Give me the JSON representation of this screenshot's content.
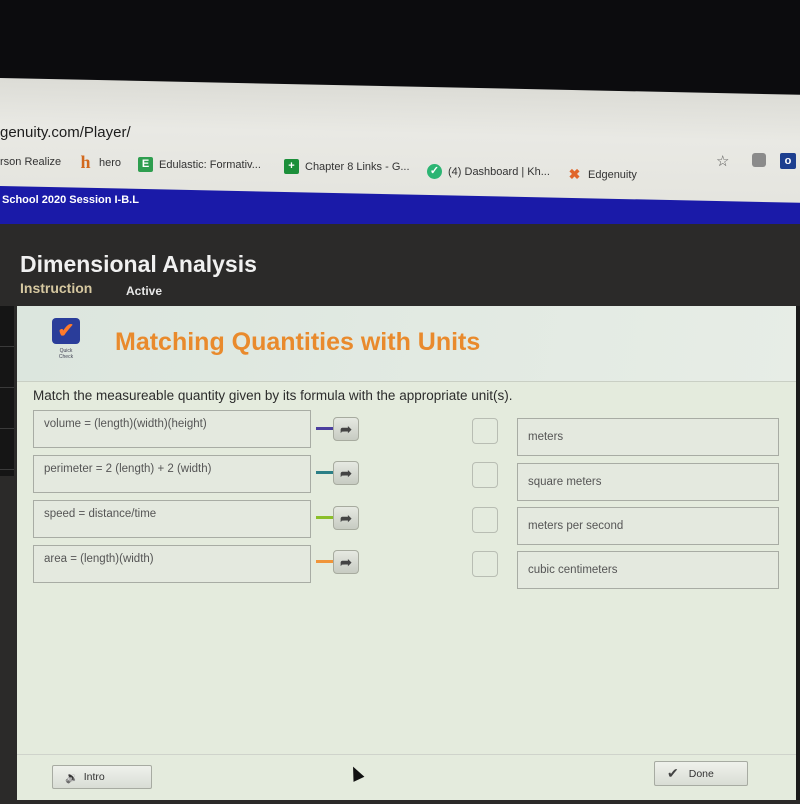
{
  "browser": {
    "url": "genuity.com/Player/",
    "bookmarks": [
      {
        "label": "rson Realize",
        "icon": "pearson-icon",
        "color": ""
      },
      {
        "label": "hero",
        "icon": "h",
        "color": "#d2691e"
      },
      {
        "label": "Edulastic: Formativ...",
        "icon": "E",
        "color": "#2e9e4f"
      },
      {
        "label": "Chapter 8 Links - G...",
        "icon": "+",
        "color": "#1c8f3a"
      },
      {
        "label": "(4) Dashboard | Kh...",
        "icon": "✓",
        "color": "#2cb573"
      },
      {
        "label": "Edgenuity",
        "icon": "✖",
        "color": "#e0662b"
      }
    ],
    "star_icon": "☆",
    "extension_label": "o"
  },
  "course_bar": {
    "title": "School 2020 Session I-B.L"
  },
  "lesson": {
    "title": "Dimensional Analysis",
    "tabs": [
      {
        "label": "Instruction"
      },
      {
        "label": "Active"
      }
    ]
  },
  "activity": {
    "badge_icon": "✔",
    "badge_label_1": "Quick",
    "badge_label_2": "Check",
    "title": "Matching Quantities with Units",
    "prompt": "Match the measureable quantity given by its formula with the appropriate unit(s).",
    "left_items": [
      {
        "text": "volume = (length)(width)(height)",
        "connector_color": "#4b3f9e"
      },
      {
        "text": "perimeter = 2 (length) + 2 (width)",
        "connector_color": "#2b7f86"
      },
      {
        "text": "speed = distance/time",
        "connector_color": "#8bbf2a"
      },
      {
        "text": "area = (length)(width)",
        "connector_color": "#f0953a"
      }
    ],
    "arrow_glyph": "➦",
    "right_items": [
      {
        "text": "meters"
      },
      {
        "text": "square meters"
      },
      {
        "text": "meters per second"
      },
      {
        "text": "cubic centimeters"
      }
    ]
  },
  "footer": {
    "intro_label": "Intro",
    "intro_icon": "🔉",
    "done_label": "Done",
    "done_icon": "✔"
  }
}
